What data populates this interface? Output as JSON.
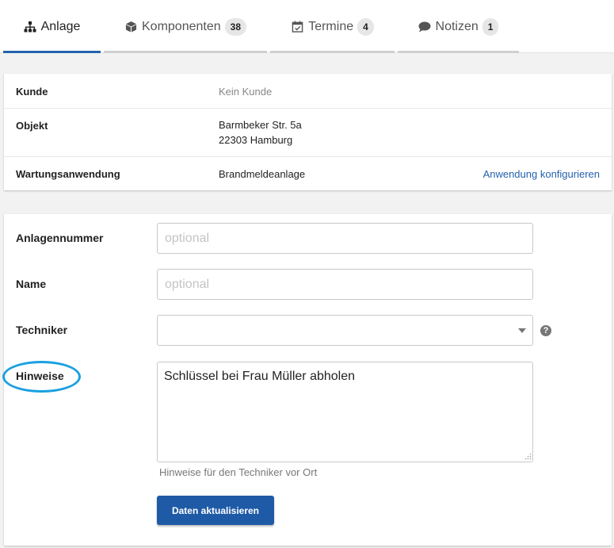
{
  "tabs": [
    {
      "label": "Anlage",
      "icon": "sitemap-icon",
      "count": ""
    },
    {
      "label": "Komponenten",
      "icon": "cube-icon",
      "count": "38"
    },
    {
      "label": "Termine",
      "icon": "calendar-check-icon",
      "count": "4"
    },
    {
      "label": "Notizen",
      "icon": "comment-icon",
      "count": "1"
    }
  ],
  "info": {
    "customer_label": "Kunde",
    "customer_value": "Kein Kunde",
    "object_label": "Objekt",
    "object_line1": "Barmbeker Str. 5a",
    "object_line2": "22303 Hamburg",
    "application_label": "Wartungsanwendung",
    "application_value": "Brandmeldeanlage",
    "configure_link": "Anwendung konfigurieren"
  },
  "form": {
    "number_label": "Anlagennummer",
    "number_value": "",
    "number_placeholder": "optional",
    "name_label": "Name",
    "name_value": "",
    "name_placeholder": "optional",
    "technician_label": "Techniker",
    "technician_value": "",
    "help_symbol": "?",
    "notes_label": "Hinweise",
    "notes_value": "Schlüssel bei Frau Müller abholen",
    "notes_hint": "Hinweise für den Techniker vor Ort",
    "submit_label": "Daten aktualisieren"
  },
  "colors": {
    "accent": "#2462ad",
    "button": "#1f5aa6",
    "annotation": "#1aa0e0"
  }
}
